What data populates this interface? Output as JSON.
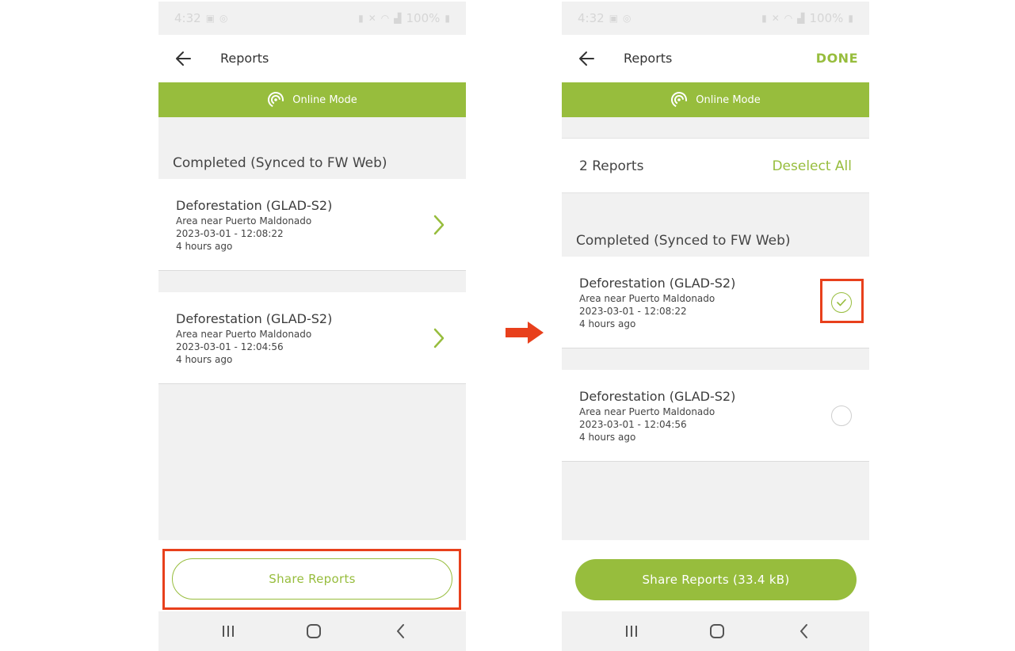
{
  "status_bar": {
    "time": "4:32",
    "battery": "100%"
  },
  "colors": {
    "accent": "#97bd3d",
    "highlight": "#e8401c",
    "background": "#f1f1f1"
  },
  "left_screen": {
    "header": {
      "title": "Reports"
    },
    "banner": {
      "label": "Online Mode"
    },
    "section_title": "Completed (Synced to FW Web)",
    "reports": [
      {
        "title": "Deforestation (GLAD-S2)",
        "area": "Area near Puerto Maldonado",
        "datetime": "2023-03-01 - 12:08:22",
        "age": "4 hours ago"
      },
      {
        "title": "Deforestation (GLAD-S2)",
        "area": "Area near Puerto Maldonado",
        "datetime": "2023-03-01 - 12:04:56",
        "age": "4 hours ago"
      }
    ],
    "share_button": "Share Reports"
  },
  "right_screen": {
    "header": {
      "title": "Reports",
      "done": "DONE"
    },
    "banner": {
      "label": "Online Mode"
    },
    "selection": {
      "count": "2 Reports",
      "deselect": "Deselect All"
    },
    "section_title": "Completed (Synced to FW Web)",
    "reports": [
      {
        "title": "Deforestation (GLAD-S2)",
        "area": "Area near Puerto Maldonado",
        "datetime": "2023-03-01 - 12:08:22",
        "age": "4 hours ago",
        "selected": true
      },
      {
        "title": "Deforestation (GLAD-S2)",
        "area": "Area near Puerto Maldonado",
        "datetime": "2023-03-01 - 12:04:56",
        "age": "4 hours ago",
        "selected": false
      }
    ],
    "share_button": "Share Reports (33.4 kB)"
  },
  "icons": {
    "back": "arrow-left-icon",
    "online": "signal-broadcast-icon",
    "chevron": "chevron-right-icon",
    "check": "check-icon",
    "nav_recents": "recent-apps-icon",
    "nav_home": "home-icon",
    "nav_back": "nav-back-icon",
    "flow_arrow": "arrow-right-icon"
  }
}
